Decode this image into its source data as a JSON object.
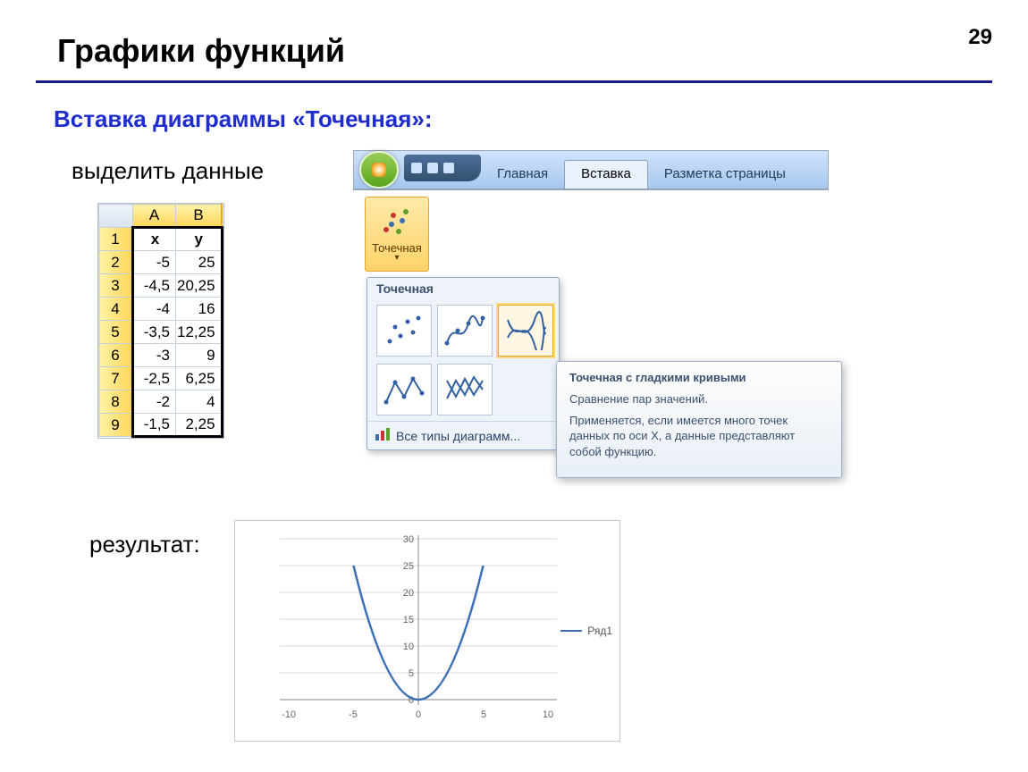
{
  "page_number": "29",
  "title": "Графики функций",
  "subtitle": "Вставка диаграммы «Точечная»:",
  "select_label": "выделить данные",
  "result_label": "результат:",
  "spreadsheet": {
    "col_headers": [
      "A",
      "B"
    ],
    "row_headers": [
      "1",
      "2",
      "3",
      "4",
      "5",
      "6",
      "7",
      "8",
      "9"
    ],
    "data_header": [
      "x",
      "y"
    ],
    "rows": [
      [
        "-5",
        "25"
      ],
      [
        "-4,5",
        "20,25"
      ],
      [
        "-4",
        "16"
      ],
      [
        "-3,5",
        "12,25"
      ],
      [
        "-3",
        "9"
      ],
      [
        "-2,5",
        "6,25"
      ],
      [
        "-2",
        "4"
      ],
      [
        "-1,5",
        "2,25"
      ]
    ]
  },
  "ribbon": {
    "tabs": {
      "home": "Главная",
      "insert": "Вставка",
      "layout": "Разметка страницы"
    },
    "scatter_button": "Точечная"
  },
  "gallery": {
    "header": "Точечная",
    "all_link": "Все типы диаграмм..."
  },
  "tooltip": {
    "title": "Точечная с гладкими кривыми",
    "line1": "Сравнение пар значений.",
    "line2": "Применяется, если имеется много точек данных по оси X, а данные представляют собой функцию."
  },
  "chart": {
    "legend": "Ряд1",
    "y_ticks": [
      "30",
      "25",
      "20",
      "15",
      "10",
      "5",
      "0"
    ],
    "x_ticks": [
      "-10",
      "-5",
      "0",
      "5",
      "10"
    ]
  },
  "chart_data": {
    "type": "line",
    "title": "",
    "xlabel": "",
    "ylabel": "",
    "xlim": [
      -10,
      10
    ],
    "ylim": [
      0,
      30
    ],
    "y_ticks": [
      0,
      5,
      10,
      15,
      20,
      25,
      30
    ],
    "x_ticks": [
      -10,
      -5,
      0,
      5,
      10
    ],
    "legend": [
      "Ряд1"
    ],
    "series": [
      {
        "name": "Ряд1",
        "x": [
          -5,
          -4.5,
          -4,
          -3.5,
          -3,
          -2.5,
          -2,
          -1.5,
          -1,
          -0.5,
          0,
          0.5,
          1,
          1.5,
          2,
          2.5,
          3,
          3.5,
          4,
          4.5,
          5
        ],
        "y": [
          25,
          20.25,
          16,
          12.25,
          9,
          6.25,
          4,
          2.25,
          1,
          0.25,
          0,
          0.25,
          1,
          2.25,
          4,
          6.25,
          9,
          12.25,
          16,
          20.25,
          25
        ]
      }
    ]
  }
}
